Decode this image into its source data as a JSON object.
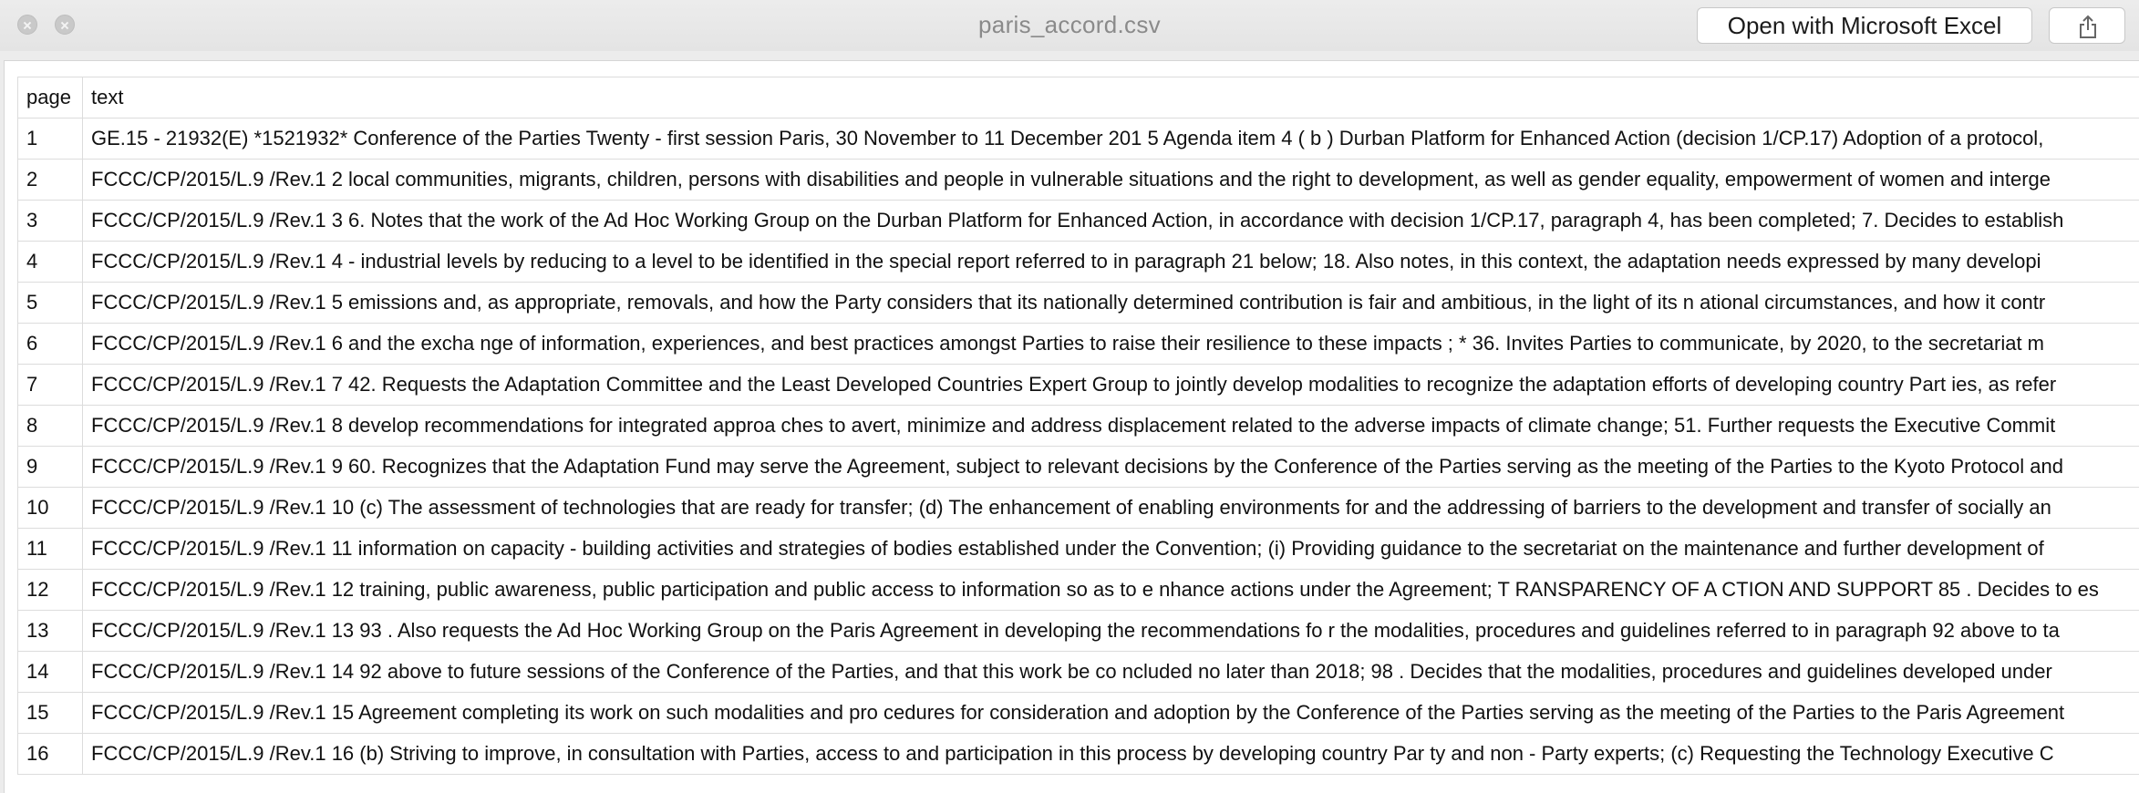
{
  "window": {
    "title": "paris_accord.csv",
    "open_button_label": "Open with Microsoft Excel",
    "close_icon": "close-icon",
    "minimize_icon": "minimize-icon",
    "share_icon": "share-icon"
  },
  "table": {
    "headers": [
      "page",
      "text"
    ],
    "rows": [
      [
        "1",
        "GE.15 - 21932(E) *1521932* Conference of the Parties Twenty - first session Paris, 30 November to 11 December 201 5 Agenda item 4 ( b ) Durban Platform for Enhanced Action (decision 1/CP.17) Adoption of a protocol,"
      ],
      [
        "2",
        "FCCC/CP/2015/L.9 /Rev.1 2 local communities, migrants, children, persons with disabilities and people in vulnerable situations and the right to development, as well as gender equality, empowerment of women and interge"
      ],
      [
        "3",
        "FCCC/CP/2015/L.9 /Rev.1 3 6. Notes that the work of the Ad Hoc Working Group on the Durban Platform for Enhanced Action, in accordance with decision 1/CP.17, paragraph 4, has been completed; 7. Decides to establish"
      ],
      [
        "4",
        "FCCC/CP/2015/L.9 /Rev.1 4 - industrial levels by reducing to a level to be identified in the special report referred to in paragraph 21 below; 18. Also notes, in this context, the adaptation needs expressed by many developi"
      ],
      [
        "5",
        "FCCC/CP/2015/L.9 /Rev.1 5 emissions and, as appropriate, removals, and how the Party considers that its nationally determined contribution is fair and ambitious, in the light of its n ational circumstances, and how it contr"
      ],
      [
        "6",
        "FCCC/CP/2015/L.9 /Rev.1 6 and the excha nge of information, experiences, and best practices amongst Parties to raise their resilience to these impacts ; * 36. Invites Parties to communicate, by 2020, to the secretariat m"
      ],
      [
        "7",
        "FCCC/CP/2015/L.9 /Rev.1 7 42. Requests the Adaptation Committee and the Least Developed Countries Expert Group to jointly develop modalities to recognize the adaptation efforts of developing country Part ies, as refer"
      ],
      [
        "8",
        "FCCC/CP/2015/L.9 /Rev.1 8 develop recommendations for integrated approa ches to avert, minimize and address displacement related to the adverse impacts of climate change; 51. Further requests the Executive Commit"
      ],
      [
        "9",
        "FCCC/CP/2015/L.9 /Rev.1 9 60. Recognizes that the Adaptation Fund may serve the Agreement, subject to relevant decisions by the Conference of the Parties serving as the meeting of the Parties to the Kyoto Protocol and"
      ],
      [
        "10",
        "FCCC/CP/2015/L.9 /Rev.1 10 (c) The assessment of technologies that are ready for transfer; (d) The enhancement of enabling environments for and the addressing of barriers to the development and transfer of socially an"
      ],
      [
        "11",
        "FCCC/CP/2015/L.9 /Rev.1 11 information on capacity - building activities and strategies of bodies established under the Convention; (i) Providing guidance to the secretariat on the maintenance and further development of"
      ],
      [
        "12",
        "FCCC/CP/2015/L.9 /Rev.1 12 training, public awareness, public participation and public access to information so as to e nhance actions under the Agreement; T RANSPARENCY OF A CTION AND SUPPORT 85 . Decides to es"
      ],
      [
        "13",
        "FCCC/CP/2015/L.9 /Rev.1 13 93 . Also requests the Ad Hoc Working Group on the Paris Agreement in developing the recommendations fo r the modalities, procedures and guidelines referred to in paragraph 92 above to ta"
      ],
      [
        "14",
        "FCCC/CP/2015/L.9 /Rev.1 14 92 above to future sessions of the Conference of the Parties, and that this work be co ncluded no later than 2018; 98 . Decides that the modalities, procedures and guidelines developed under"
      ],
      [
        "15",
        "FCCC/CP/2015/L.9 /Rev.1 15 Agreement completing its work on such modalities and pro cedures for consideration and adoption by the Conference of the Parties serving as the meeting of the Parties to the Paris Agreement"
      ],
      [
        "16",
        "FCCC/CP/2015/L.9 /Rev.1 16 (b) Striving to improve, in consultation with Parties, access to and participation in this process by developing country Par ty and non - Party experts; (c) Requesting the Technology Executive C"
      ]
    ]
  }
}
